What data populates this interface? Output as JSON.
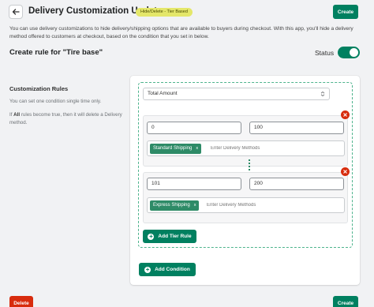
{
  "header": {
    "title": "Delivery Customization Update",
    "badge": "Hide/Delete - Tier Based",
    "create_label": "Create",
    "back_icon": "arrow-left-icon"
  },
  "description": "You can use delivery customizations to hide delivery/shipping options that are available to buyers during checkout. With this app, you'll hide a delivery method offered to customers at checkout, based on the condition that you set in below.",
  "rule": {
    "title": "Create rule for \"Tire base\"",
    "status_label": "Status",
    "status_on": true
  },
  "section": {
    "title": "Customization Rules",
    "help_1": "You can set one condition single time only.",
    "help_2_prefix": "If ",
    "help_2_bold": "All",
    "help_2_suffix": " rules become true, then it will delete a Delivery method."
  },
  "condition": {
    "selected": "Total Amount",
    "tiers": [
      {
        "min": "0",
        "max": "100",
        "method": "Standard Shipping",
        "remove_x": "x",
        "placeholder": "Enter Delivery Methods"
      },
      {
        "min": "101",
        "max": "200",
        "method": "Express Shipping",
        "remove_x": "x",
        "placeholder": "Enter Delivery Methods"
      }
    ],
    "add_tier_label": "Add Tier Rule"
  },
  "add_condition_label": "Add Condition",
  "footer": {
    "delete_label": "Delete",
    "create_label": "Create"
  },
  "colors": {
    "primary": "#008060",
    "danger": "#d72c0d",
    "badge": "#e4e76a",
    "tag": "#2e8b67"
  }
}
